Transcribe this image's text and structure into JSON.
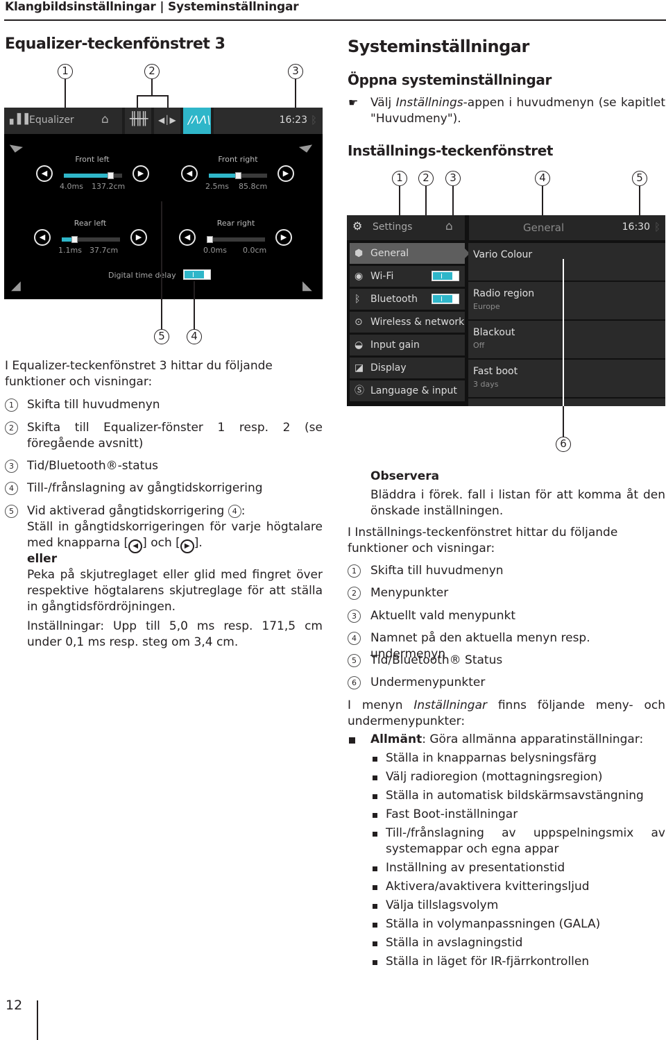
{
  "page": {
    "header": "Klangbildsinställningar | Systeminställningar",
    "page_number": "12"
  },
  "left": {
    "title": "Equalizer-teckenfönstret 3",
    "callouts_top": [
      "1",
      "2",
      "3"
    ],
    "callouts_bottom": [
      "5",
      "4"
    ],
    "eq_screen": {
      "title": "Equalizer",
      "time": "16:23",
      "icons": [
        "equalizer-bars-icon",
        "home-icon",
        "mixer-sliders-icon",
        "balance-icon",
        "curve-icon",
        "bluetooth-icon"
      ],
      "speakers": [
        {
          "name": "Front left",
          "ms": "4.0ms",
          "cm": "137.2cm",
          "fill_fraction": 0.8
        },
        {
          "name": "Front right",
          "ms": "2.5ms",
          "cm": "85.8cm",
          "fill_fraction": 0.5
        },
        {
          "name": "Rear left",
          "ms": "1.1ms",
          "cm": "37.7cm",
          "fill_fraction": 0.22
        },
        {
          "name": "Rear right",
          "ms": "0.0ms",
          "cm": "0.0cm",
          "fill_fraction": 0.0
        }
      ],
      "toggle_label": "Digital time delay",
      "toggle_state": "on"
    },
    "intro": "I Equalizer-teckenfönstret 3 hittar du följande funktioner och visningar:",
    "items": [
      {
        "num": "1",
        "text": "Skifta till huvudmenyn"
      },
      {
        "num": "2",
        "text": "Skifta till Equalizer-fönster 1 resp. 2 (se föregående avsnitt)"
      },
      {
        "num": "3",
        "text": "Tid/Bluetooth®-status"
      },
      {
        "num": "4",
        "text": "Till-/frånslagning av gångtidskorrigering"
      },
      {
        "num": "5",
        "text": "Vid aktiverad gångtidskorrigering"
      }
    ],
    "item5_ref": "4",
    "item5_line2": "Ställ in gångtidskorrigeringen för varje högtalare",
    "item5_line3_a": "med knapparna [",
    "item5_line3_b": "] och [",
    "item5_line3_c": "].",
    "item5_or": "eller",
    "item5_para": "Peka på skjutreglaget eller glid med fingret över respektive högtalarens skjutreglage för att ställa in gångtidsfördröjningen.",
    "item5_settings": "Inställningar: Upp till 5,0 ms resp. 171,5 cm under 0,1 ms resp. steg om 3,4 cm."
  },
  "right": {
    "title": "Systeminställningar",
    "subtitle": "Öppna systeminställningar",
    "instruction_pre": "Välj ",
    "instruction_italic": "Inställnings",
    "instruction_post": "-appen i huvudmenyn (se kapitlet \"Huvudmeny\").",
    "section_title": "Inställnings-teckenfönstret",
    "callouts_top": [
      "1",
      "2",
      "3",
      "4",
      "5"
    ],
    "callout_bottom": "6",
    "settings_screen": {
      "title": "Settings",
      "panel_title": "General",
      "time": "16:30",
      "menu": [
        {
          "label": "General",
          "icon": "cube-icon",
          "active": true
        },
        {
          "label": "Wi-Fi",
          "icon": "wifi-icon",
          "toggle": "on"
        },
        {
          "label": "Bluetooth",
          "icon": "bluetooth-icon",
          "toggle": "on"
        },
        {
          "label": "Wireless & network",
          "icon": "network-icon"
        },
        {
          "label": "Input gain",
          "icon": "gauge-icon"
        },
        {
          "label": "Display",
          "icon": "display-icon"
        },
        {
          "label": "Language & input",
          "icon": "language-icon"
        }
      ],
      "submenu": [
        {
          "title": "Vario Colour",
          "value": ""
        },
        {
          "title": "Radio region",
          "value": "Europe"
        },
        {
          "title": "Blackout",
          "value": "Off"
        },
        {
          "title": "Fast boot",
          "value": "3 days"
        }
      ]
    },
    "note_title": "Observera",
    "note_text": "Bläddra i förek. fall i listan för att komma åt den önskade inställningen.",
    "intro": "I Inställnings-teckenfönstret hittar du följande funktioner och visningar:",
    "items": [
      {
        "num": "1",
        "text": "Skifta till huvudmenyn"
      },
      {
        "num": "2",
        "text": "Menypunkter"
      },
      {
        "num": "3",
        "text": "Aktuellt vald menypunkt"
      },
      {
        "num": "4",
        "text": "Namnet på den aktuella menyn resp. undermenyn"
      },
      {
        "num": "5",
        "text": "Tid/Bluetooth® Status"
      },
      {
        "num": "6",
        "text": "Undermenypunkter"
      }
    ],
    "menu_intro_pre": "I menyn ",
    "menu_intro_italic": "Inställningar",
    "menu_intro_post": " finns följande meny- och undermenypunkter:",
    "general_bold": "Allmänt",
    "general_text": ": Göra allmänna apparatinställningar:",
    "general_subitems": [
      "Ställa in knapparnas belysningsfärg",
      "Välj radioregion (mottagningsregion)",
      "Ställa in automatisk bildskärmsavstängning",
      "Fast Boot-inställningar",
      "Till-/frånslagning av uppspelningsmix av systemappar och egna appar",
      "Inställning av presentationstid",
      "Aktivera/avaktivera kvitteringsljud",
      "Välja tillslagsvolym",
      "Ställa in volymanpassningen (GALA)",
      "Ställa in avslagningstid",
      "Ställa in läget för IR-fjärrkontrollen"
    ]
  }
}
